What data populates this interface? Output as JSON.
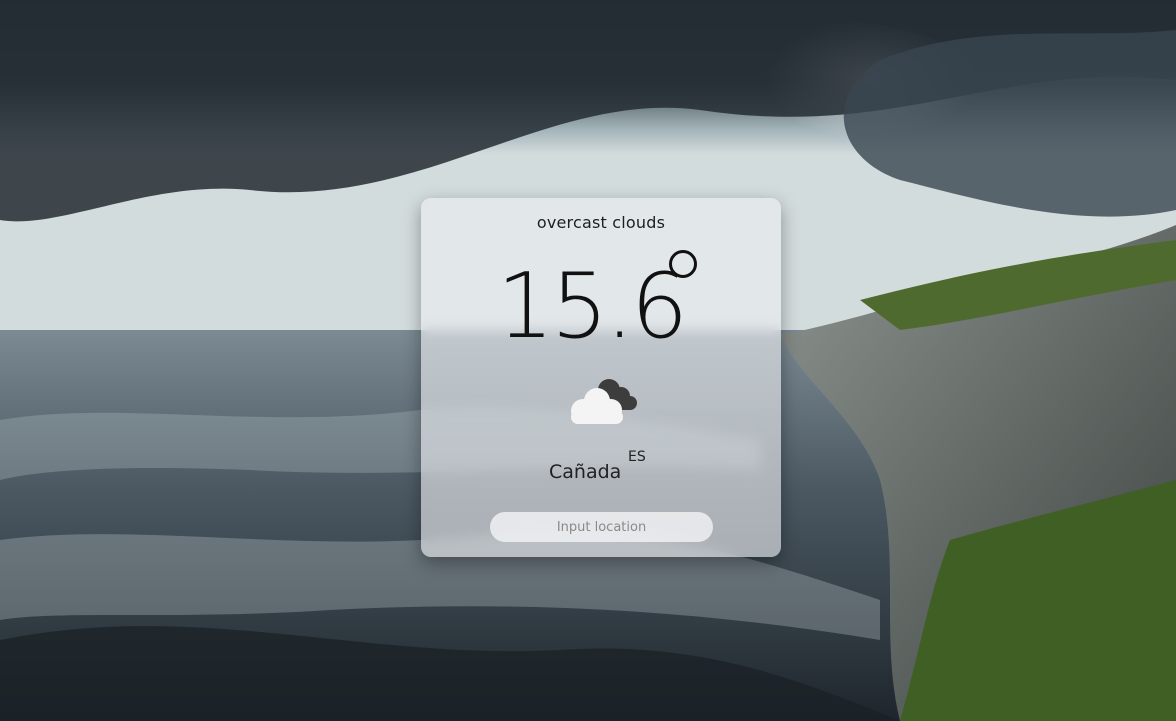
{
  "weather": {
    "description": "overcast clouds",
    "temperature": "15.6",
    "icon": "overcast-clouds-icon"
  },
  "location": {
    "city": "Cañada",
    "country": "ES"
  },
  "search": {
    "placeholder": "Input location",
    "value": ""
  },
  "background": {
    "scene": "stormy-coastline-photo",
    "colors": {
      "sky_dark": "#2f3a42",
      "sky_light": "#c9d3d6",
      "sea": "#5d6b75",
      "cliff": "#6e7670",
      "grass": "#4a6b2c"
    }
  }
}
